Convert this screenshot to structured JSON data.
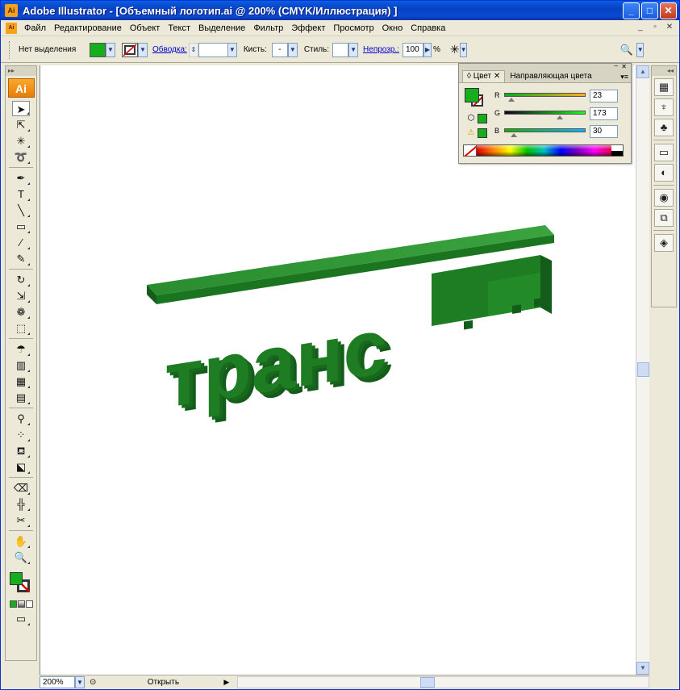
{
  "window": {
    "app_icon": "Ai",
    "title": "Adobe Illustrator - [Объемный логотип.ai @ 200% (CMYK/Иллюстрация) ]",
    "controls": [
      "_",
      "□",
      "✕"
    ]
  },
  "menubar": {
    "icon": "Ai",
    "items": [
      "Файл",
      "Редактирование",
      "Объект",
      "Текст",
      "Выделение",
      "Фильтр",
      "Эффект",
      "Просмотр",
      "Окно",
      "Справка"
    ],
    "right_controls": [
      "_",
      "▫",
      "✕"
    ]
  },
  "controlbar": {
    "selection_label": "Нет выделения",
    "fill_color": "#17ad1e",
    "stroke_link": "Обводка:",
    "brush_label": "Кисть:",
    "brush_value": "-",
    "style_label": "Стиль:",
    "opacity_link": "Непрозр.:",
    "opacity_value": "100",
    "opacity_unit": "%"
  },
  "toolbox": {
    "logo": "Ai",
    "tools": [
      {
        "icon": "selection-icon",
        "glyph": "➤"
      },
      {
        "icon": "direct-selection-icon",
        "glyph": "⇱"
      },
      {
        "icon": "magic-wand-icon",
        "glyph": "✳"
      },
      {
        "icon": "lasso-icon",
        "glyph": "➰"
      },
      {
        "icon": "pen-icon",
        "glyph": "✒"
      },
      {
        "icon": "type-icon",
        "glyph": "T"
      },
      {
        "icon": "line-icon",
        "glyph": "╲"
      },
      {
        "icon": "rectangle-icon",
        "glyph": "▭"
      },
      {
        "icon": "paintbrush-icon",
        "glyph": "∕"
      },
      {
        "icon": "pencil-icon",
        "glyph": "✎"
      },
      {
        "icon": "rotate-icon",
        "glyph": "↻"
      },
      {
        "icon": "scale-icon",
        "glyph": "⇲"
      },
      {
        "icon": "warp-icon",
        "glyph": "❁"
      },
      {
        "icon": "free-transform-icon",
        "glyph": "⬚"
      },
      {
        "icon": "symbol-sprayer-icon",
        "glyph": "☂"
      },
      {
        "icon": "column-graph-icon",
        "glyph": "▥"
      },
      {
        "icon": "mesh-icon",
        "glyph": "▦"
      },
      {
        "icon": "gradient-icon",
        "glyph": "▤"
      },
      {
        "icon": "eyedropper-icon",
        "glyph": "⚲"
      },
      {
        "icon": "blend-icon",
        "glyph": "⁘"
      },
      {
        "icon": "live-paint-bucket-icon",
        "glyph": "⛾"
      },
      {
        "icon": "live-paint-selection-icon",
        "glyph": "⬕"
      },
      {
        "icon": "eraser-icon",
        "glyph": "⌫"
      },
      {
        "icon": "slice-icon",
        "glyph": "╬"
      },
      {
        "icon": "scissors-icon",
        "glyph": "✂"
      },
      {
        "icon": "hand-icon",
        "glyph": "✋"
      },
      {
        "icon": "zoom-icon",
        "glyph": "🔍"
      }
    ],
    "fill_color": "#17ad1e"
  },
  "logo": {
    "text": "транс",
    "front_color": "#1e7d22",
    "side_color": "#14601a"
  },
  "color_panel": {
    "tabs": [
      "Цвет",
      "Направляющая цвета"
    ],
    "fill_color": "#17ad1e",
    "channels": [
      {
        "label": "R",
        "value": "23",
        "fraction": 0.09,
        "gradient": "linear-gradient(to right, #00ad1e, #ffad1e)"
      },
      {
        "label": "G",
        "value": "173",
        "fraction": 0.68,
        "gradient": "linear-gradient(to right, #17001e, #17ff1e)"
      },
      {
        "label": "B",
        "value": "30",
        "fraction": 0.12,
        "gradient": "linear-gradient(to right, #17ad00, #17adff)"
      }
    ]
  },
  "statusbar": {
    "zoom": "200%",
    "status_text": "Открыть"
  },
  "right_dock": {
    "panels": [
      "swatches-icon",
      "brushes-icon",
      "symbols-icon",
      "stroke-icon",
      "transparency-icon",
      "appearance-icon",
      "graphic-styles-icon",
      "layers-icon"
    ]
  }
}
